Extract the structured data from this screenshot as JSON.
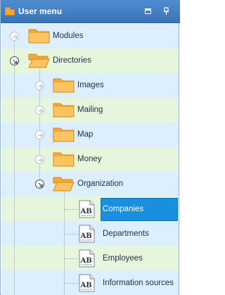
{
  "window": {
    "title": "User menu",
    "icons": [
      "folder-icon",
      "restore-window-icon",
      "pin-icon"
    ]
  },
  "tree": {
    "modules": {
      "label": "Modules",
      "state": "collapsed"
    },
    "directories": {
      "label": "Directories",
      "state": "expanded"
    },
    "images": {
      "label": "Images",
      "state": "collapsed"
    },
    "mailing": {
      "label": "Mailing",
      "state": "collapsed"
    },
    "map": {
      "label": "Map",
      "state": "collapsed"
    },
    "money": {
      "label": "Money",
      "state": "collapsed"
    },
    "organization": {
      "label": "Organization",
      "state": "expanded"
    },
    "companies": {
      "label": "Companies",
      "selected": true
    },
    "departments": {
      "label": "Departments"
    },
    "employees": {
      "label": "Employees"
    },
    "information_sources": {
      "label": "Information sources"
    }
  },
  "colors": {
    "title_bar": "#3f7bbf",
    "row_green": "#e6f6dd",
    "row_blue": "#ddeefe",
    "selection": "#1a8fe0",
    "folder": "#f5a73a"
  }
}
